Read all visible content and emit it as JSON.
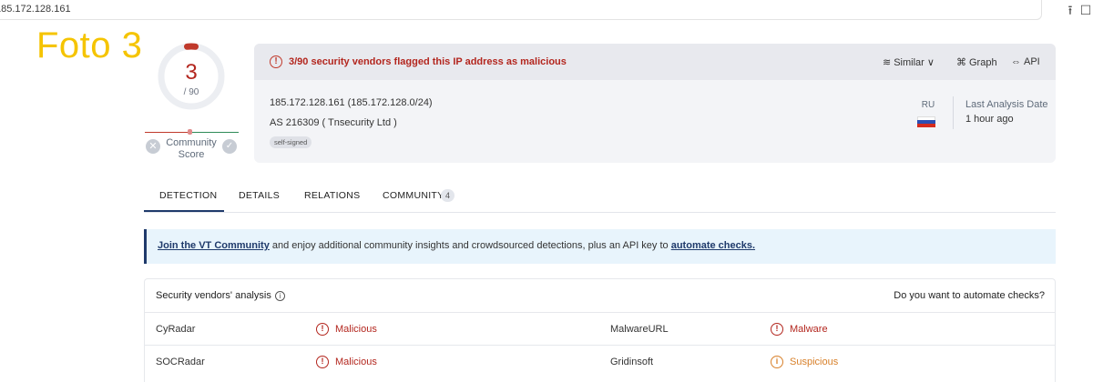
{
  "browser": {
    "url": "185.172.128.161",
    "share_icon": "share-icon",
    "bookmark_icon": "bookmark-icon"
  },
  "overlay_label": "Foto 3",
  "score": {
    "detections": "3",
    "total": "/ 90",
    "community_label_line1": "Community",
    "community_label_line2": "Score"
  },
  "summary": {
    "alert": "3/90 security vendors flagged this IP address as malicious",
    "actions": {
      "similar": "Similar",
      "graph": "Graph",
      "api": "API"
    },
    "ip_line": "185.172.128.161  (185.172.128.0/24)",
    "as_line": "AS 216309  ( Tnsecurity Ltd )",
    "tag": "self-signed",
    "country": "RU",
    "last_analysis_label": "Last Analysis Date",
    "last_analysis_value": "1 hour ago"
  },
  "tabs": [
    {
      "label": "DETECTION"
    },
    {
      "label": "DETAILS"
    },
    {
      "label": "RELATIONS"
    },
    {
      "label": "COMMUNITY",
      "badge": "4"
    }
  ],
  "banner": {
    "link1": "Join the VT Community",
    "middle": " and enjoy additional community insights and crowdsourced detections, plus an API key to ",
    "link2": "automate checks."
  },
  "vendors": {
    "heading": "Security vendors' analysis",
    "right_prompt": "Do you want to automate checks?",
    "rows": [
      {
        "v1": "CyRadar",
        "s1": "Malicious",
        "v2": "MalwareURL",
        "s2": "Malware"
      },
      {
        "v1": "SOCRadar",
        "s1": "Malicious",
        "v2": "Gridinsoft",
        "s2": "Suspicious"
      }
    ]
  },
  "colors": {
    "malicious": "#b3261e",
    "suspicious": "#d8802a",
    "accent": "#1f3a6b",
    "overlay": "#f5c400"
  }
}
